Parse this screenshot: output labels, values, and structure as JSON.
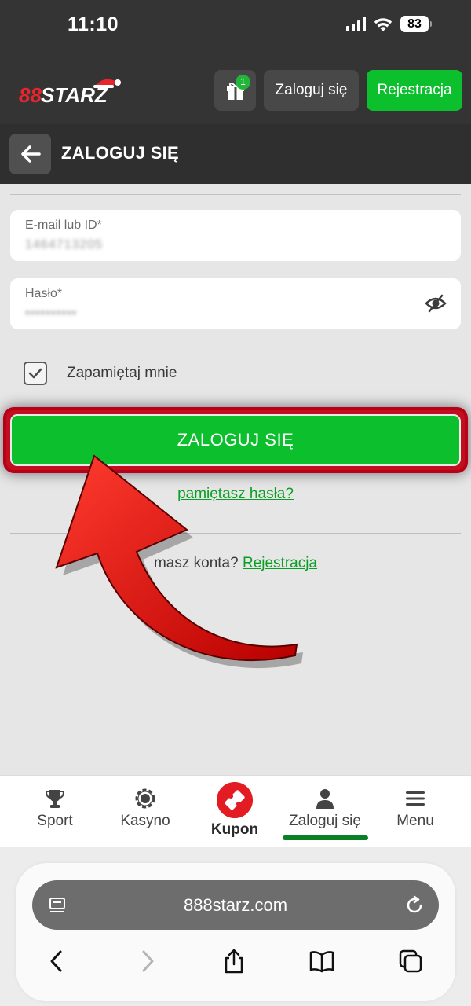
{
  "status_bar": {
    "time": "11:10",
    "battery": "83"
  },
  "header": {
    "logo_text": "888STARZ",
    "gift_badge": "1",
    "login_label": "Zaloguj się",
    "register_label": "Rejestracja"
  },
  "page": {
    "title": "ZALOGUJ SIĘ"
  },
  "form": {
    "email_label": "E-mail lub ID*",
    "email_value": "1464713205",
    "password_label": "Hasło*",
    "password_value": "••••••••••",
    "remember_label": "Zapamiętaj mnie",
    "remember_checked": true,
    "submit_label": "ZALOGUJ SIĘ",
    "forgot_label": "pamiętasz hasła?",
    "signup_prefix": "masz konta?",
    "signup_link": "Rejestracja"
  },
  "bottom_nav": {
    "items": [
      {
        "label": "Sport",
        "icon": "trophy-icon"
      },
      {
        "label": "Kasyno",
        "icon": "casino-chip-icon"
      },
      {
        "label": "Kupon",
        "icon": "ticket-icon"
      },
      {
        "label": "Zaloguj się",
        "icon": "user-icon",
        "active": true
      },
      {
        "label": "Menu",
        "icon": "hamburger-menu-icon"
      }
    ]
  },
  "browser": {
    "url": "888starz.com"
  },
  "colors": {
    "accent_green": "#0cbf2d",
    "header_bg": "#343434",
    "arrow_red": "#e01010",
    "highlight_border": "#b8001a"
  }
}
